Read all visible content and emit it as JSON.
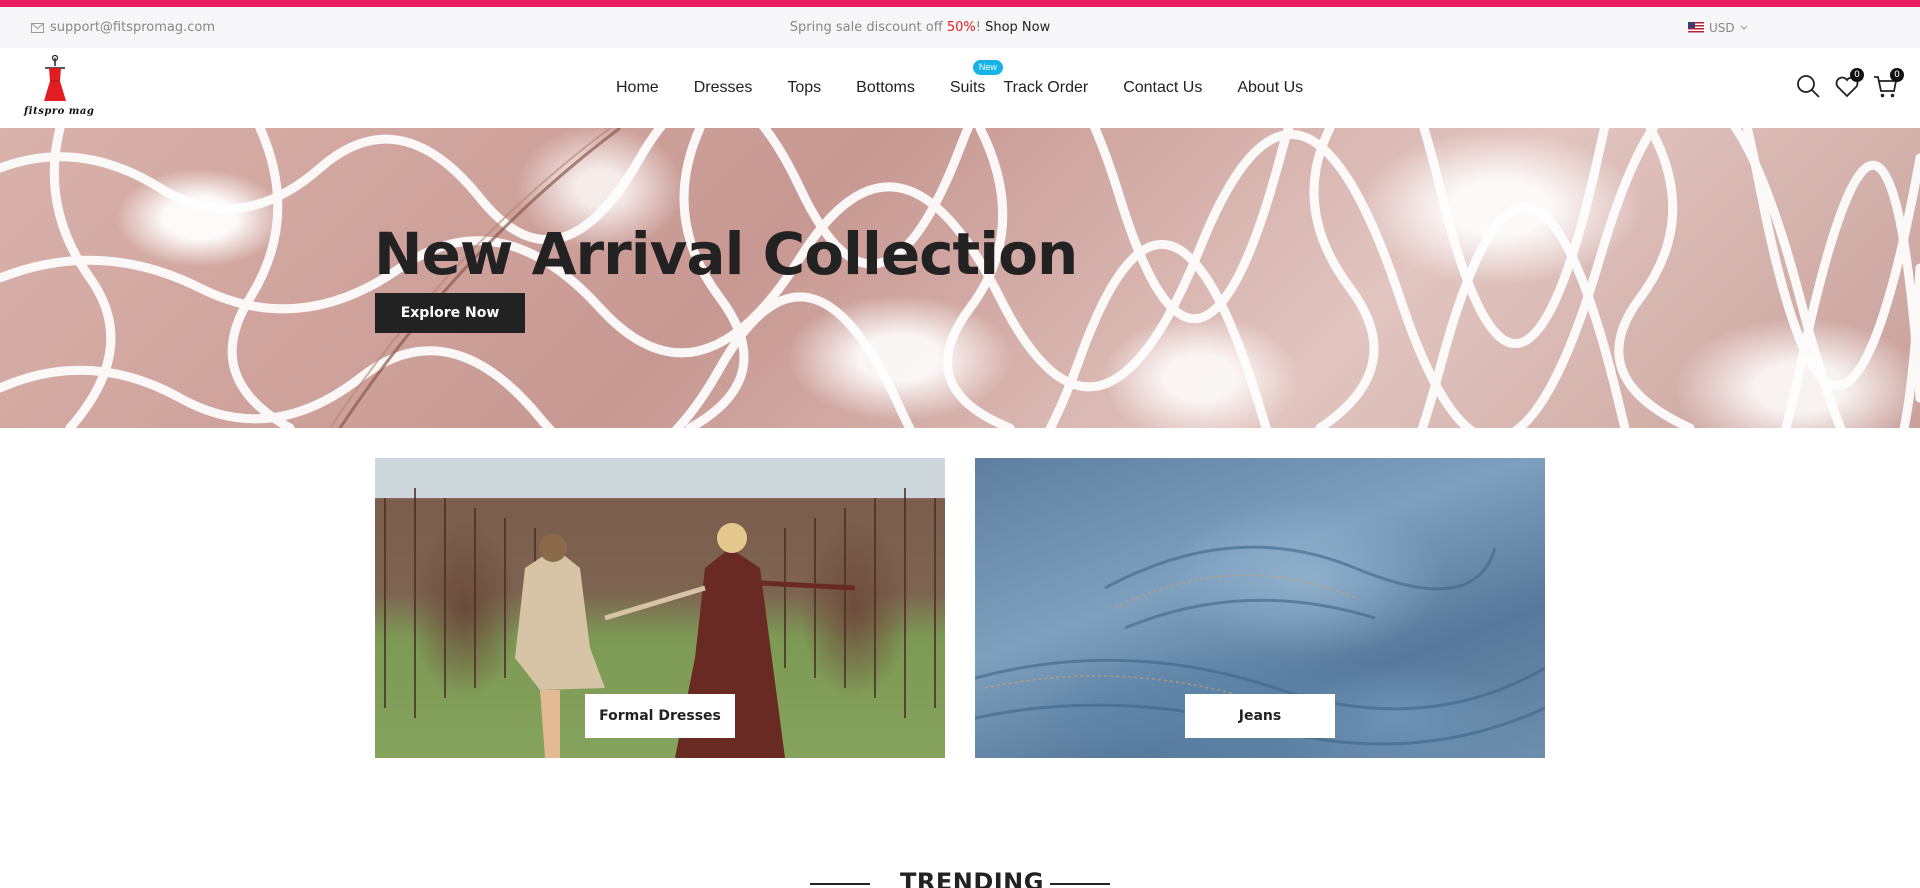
{
  "topbar": {
    "email": "support@fitspromag.com",
    "promo_prefix": "Spring sale discount off ",
    "promo_percent": "50%",
    "promo_suffix": "! ",
    "promo_link": "Shop Now",
    "currency": "USD"
  },
  "brand": {
    "name": "fitspro mag"
  },
  "nav": {
    "items": [
      "Home",
      "Dresses",
      "Tops",
      "Bottoms",
      "Suits",
      "Track Order",
      "Contact Us",
      "About Us"
    ],
    "suits_badge": "New"
  },
  "header_icons": {
    "wishlist_count": "0",
    "cart_count": "0"
  },
  "hero": {
    "title": "New Arrival Collection",
    "button": "Explore Now"
  },
  "categories": [
    {
      "label": "Formal Dresses"
    },
    {
      "label": "Jeans"
    }
  ],
  "trending": {
    "title": "TRENDING"
  },
  "colors": {
    "accent": "#e91e63",
    "badge": "#16b3e8",
    "dark": "#222222",
    "promo_percent": "#e91e1e"
  }
}
